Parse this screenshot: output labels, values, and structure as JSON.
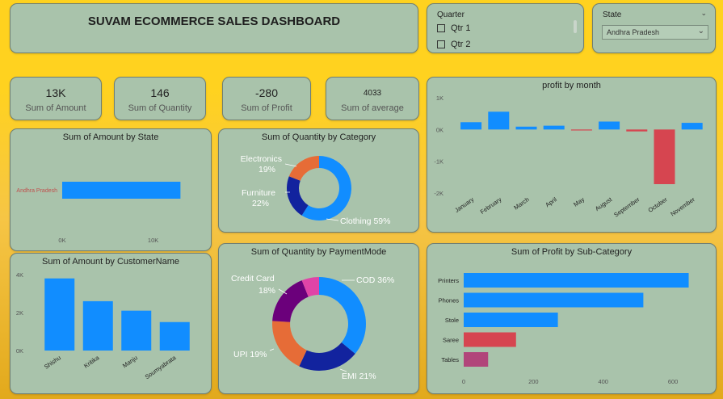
{
  "dashboard": {
    "title": "SUVAM ECOMMERCE SALES DASHBOARD"
  },
  "quarter_slicer": {
    "header": "Quarter",
    "options": [
      "Qtr 1",
      "Qtr 2"
    ]
  },
  "state_slicer": {
    "header": "State",
    "selected": "Andhra Pradesh"
  },
  "kpis": [
    {
      "value": "13K",
      "label": "Sum of Amount"
    },
    {
      "value": "146",
      "label": "Sum of Quantity"
    },
    {
      "value": "-280",
      "label": "Sum of Profit"
    },
    {
      "value": "4033",
      "label": "Sum of average"
    }
  ],
  "colors": {
    "bar": "#118dff",
    "negative": "#d64550",
    "magenta": "#b1457a"
  },
  "chart_data": [
    {
      "id": "amount_by_state",
      "type": "bar",
      "orientation": "horizontal",
      "title": "Sum of Amount by State",
      "categories": [
        "Andhra Pradesh"
      ],
      "values": [
        13000
      ],
      "xlim": [
        0,
        13500
      ],
      "x_ticks": [
        "0K",
        "10K"
      ]
    },
    {
      "id": "quantity_by_category",
      "type": "pie",
      "donut": true,
      "title": "Sum of Quantity by Category",
      "slices": [
        {
          "label": "Clothing",
          "pct": "59%",
          "value": 59,
          "color": "#118dff"
        },
        {
          "label": "Furniture",
          "pct": "22%",
          "value": 22,
          "color": "#12239e"
        },
        {
          "label": "Electronics",
          "pct": "19%",
          "value": 19,
          "color": "#e66c37"
        }
      ]
    },
    {
      "id": "profit_by_month",
      "type": "bar",
      "title": "profit by month",
      "categories": [
        "January",
        "February",
        "March",
        "April",
        "May",
        "August",
        "September",
        "October",
        "November"
      ],
      "values": [
        230,
        560,
        90,
        120,
        -30,
        250,
        -60,
        -1720,
        210
      ],
      "ylim": [
        -2000,
        1000
      ],
      "y_ticks": [
        "1K",
        "0K",
        "-1K",
        "-2K"
      ]
    },
    {
      "id": "amount_by_customer",
      "type": "bar",
      "title": "Sum of Amount by CustomerName",
      "categories": [
        "Shishu",
        "Kritika",
        "Manju",
        "Soumyabrata"
      ],
      "values": [
        3800,
        2600,
        2100,
        1500
      ],
      "ylim": [
        0,
        4000
      ],
      "y_ticks": [
        "4K",
        "2K",
        "0K"
      ]
    },
    {
      "id": "quantity_by_payment",
      "type": "pie",
      "donut": true,
      "title": "Sum of Quantity by PaymentMode",
      "slices": [
        {
          "label": "COD",
          "pct": "36%",
          "value": 36,
          "color": "#118dff"
        },
        {
          "label": "EMI",
          "pct": "21%",
          "value": 21,
          "color": "#12239e"
        },
        {
          "label": "UPI",
          "pct": "19%",
          "value": 19,
          "color": "#e66c37"
        },
        {
          "label": "Credit Card",
          "pct": "18%",
          "value": 18,
          "color": "#6b007b"
        },
        {
          "label": "",
          "pct": "",
          "value": 6,
          "color": "#e044a7"
        }
      ]
    },
    {
      "id": "profit_by_subcategory",
      "type": "bar",
      "orientation": "horizontal",
      "title": "Sum of Profit by Sub-Category",
      "categories": [
        "Printers",
        "Phones",
        "Stole",
        "Saree",
        "Tables"
      ],
      "values": [
        645,
        515,
        270,
        150,
        70
      ],
      "xlim": [
        0,
        660
      ],
      "x_ticks": [
        "0",
        "200",
        "400",
        "600"
      ]
    }
  ]
}
